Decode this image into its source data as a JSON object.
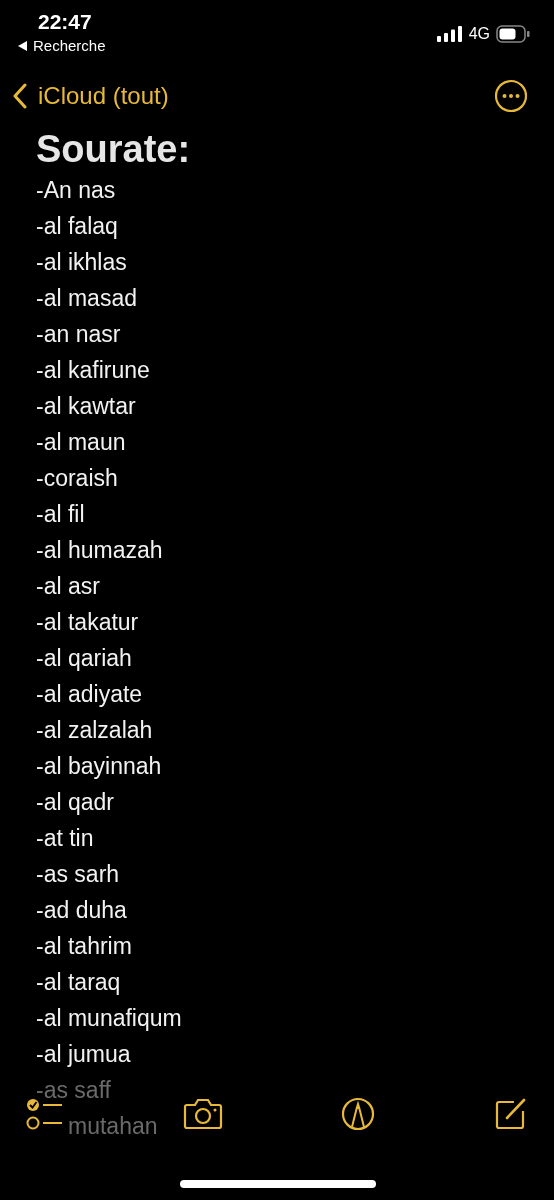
{
  "status_bar": {
    "time": "22:47",
    "back_app": "Recherche",
    "network": "4G"
  },
  "nav": {
    "back_label": "iCloud (tout)"
  },
  "note": {
    "title": "Sourate:",
    "lines": [
      {
        "text": "-An nas",
        "covered": false
      },
      {
        "text": "-al falaq",
        "covered": false
      },
      {
        "text": "-al ikhlas",
        "covered": false
      },
      {
        "text": "-al masad",
        "covered": false
      },
      {
        "text": "-an nasr",
        "covered": false
      },
      {
        "text": "-al kafirune",
        "covered": false
      },
      {
        "text": "-al kawtar",
        "covered": false
      },
      {
        "text": "-al maun",
        "covered": false
      },
      {
        "text": "-coraish",
        "covered": false
      },
      {
        "text": "-al fil",
        "covered": false
      },
      {
        "text": "-al humazah",
        "covered": false
      },
      {
        "text": "-al asr",
        "covered": false
      },
      {
        "text": "-al takatur",
        "covered": false
      },
      {
        "text": "-al qariah",
        "covered": false
      },
      {
        "text": "-al adiyate",
        "covered": false
      },
      {
        "text": "-al zalzalah",
        "covered": false
      },
      {
        "text": "-al bayinnah",
        "covered": false
      },
      {
        "text": "-al qadr",
        "covered": false
      },
      {
        "text": "-at tin",
        "covered": false
      },
      {
        "text": "-as sarh",
        "covered": false
      },
      {
        "text": "-ad duha",
        "covered": false
      },
      {
        "text": "-al tahrim",
        "covered": false
      },
      {
        "text": "-al taraq",
        "covered": false
      },
      {
        "text": "-al munafiqum",
        "covered": false
      },
      {
        "text": "-al jumua",
        "covered": false
      },
      {
        "text": "-as saff",
        "covered": true
      },
      {
        "text": "mutahan",
        "covered": true
      }
    ]
  }
}
